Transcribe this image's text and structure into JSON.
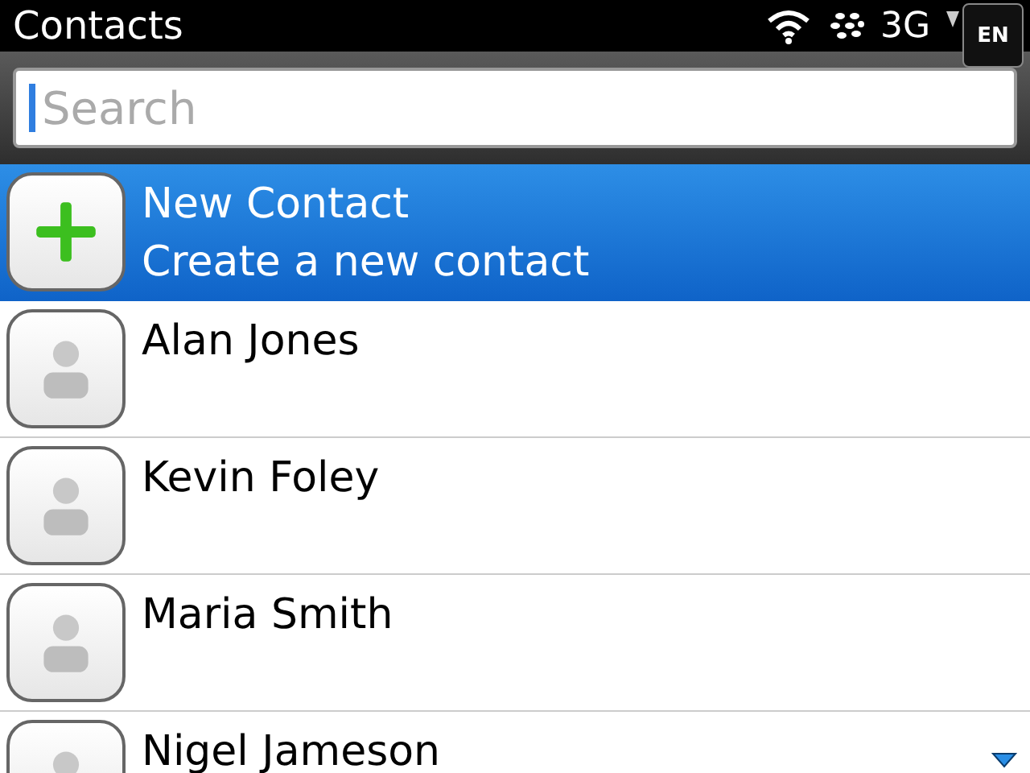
{
  "status_bar": {
    "title": "Contacts",
    "network": "3G",
    "input_language": "EN"
  },
  "search": {
    "placeholder": "Search"
  },
  "contacts": [
    {
      "kind": "new",
      "name": "New Contact",
      "subtitle": "Create a new contact",
      "selected": true
    },
    {
      "kind": "person",
      "name": "Alan Jones",
      "selected": false
    },
    {
      "kind": "person",
      "name": "Kevin Foley",
      "selected": false
    },
    {
      "kind": "person",
      "name": "Maria Smith",
      "selected": false
    },
    {
      "kind": "person",
      "name": "Nigel Jameson",
      "selected": false
    }
  ]
}
